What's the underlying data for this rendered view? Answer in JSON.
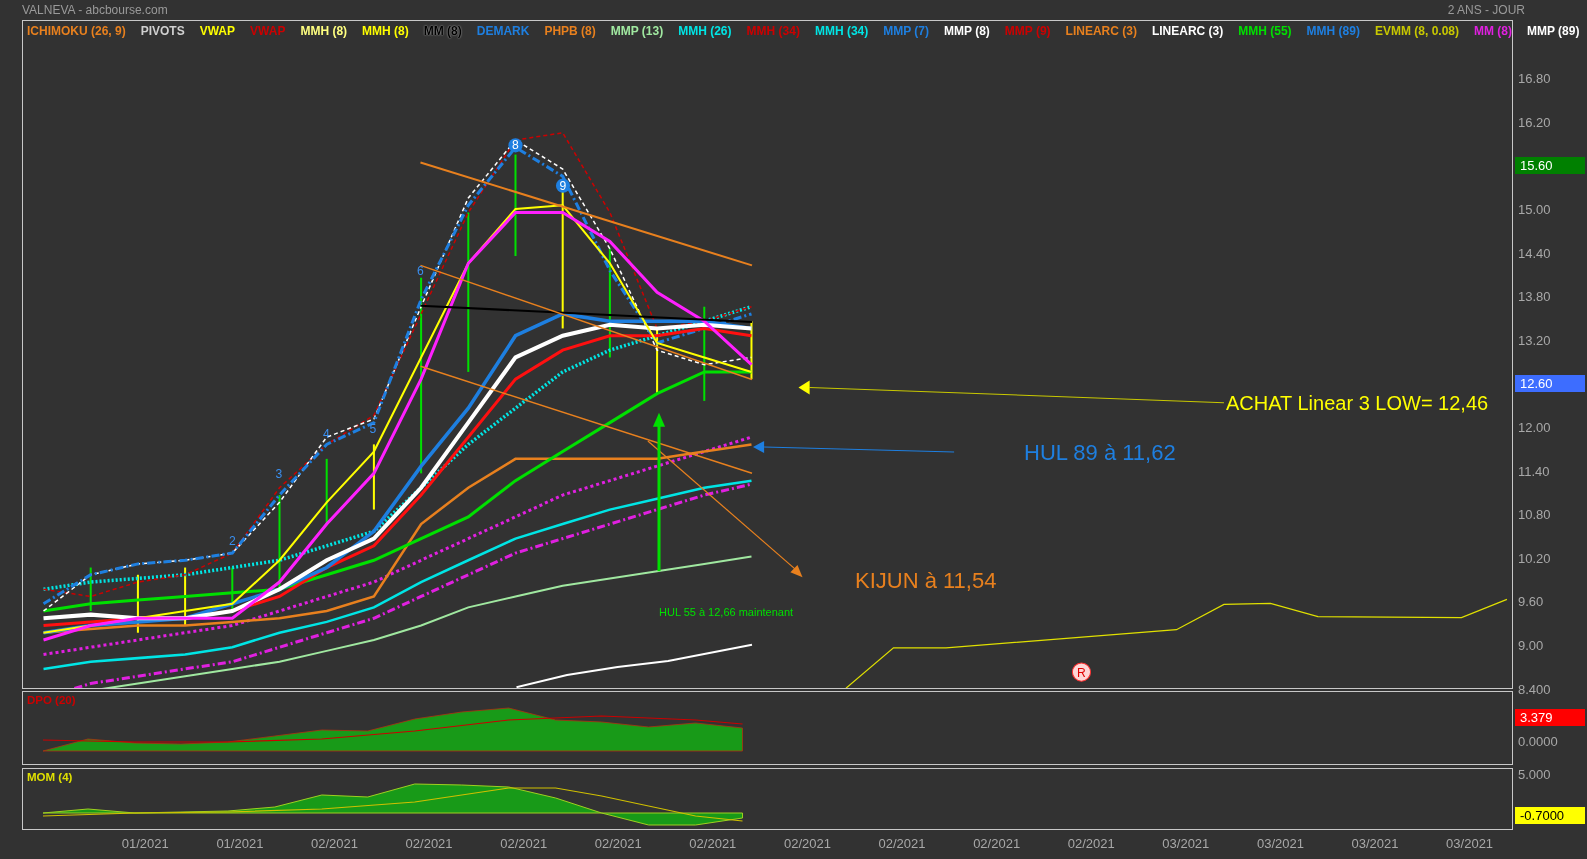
{
  "header": {
    "title": "VALNEVA - abcbourse.com",
    "period": "2 ANS - JOUR"
  },
  "legend": [
    {
      "label": "ICHIMOKU (26, 9)",
      "color": "#e8801e"
    },
    {
      "label": "PIVOTS",
      "color": "#d0d0d0"
    },
    {
      "label": "VWAP",
      "color": "#ffff00"
    },
    {
      "label": "VWAP",
      "color": "#cc0000"
    },
    {
      "label": "MMH (8)",
      "color": "#ffff80"
    },
    {
      "label": "MMH (8)",
      "color": "#ffff00"
    },
    {
      "label": "MM (8)",
      "color": "#000000"
    },
    {
      "label": "DEMARK",
      "color": "#1e7fe0"
    },
    {
      "label": "PHPB (8)",
      "color": "#e8801e"
    },
    {
      "label": "MMP (13)",
      "color": "#a0e8a0"
    },
    {
      "label": "MMH (26)",
      "color": "#00e5e5"
    },
    {
      "label": "MMH (34)",
      "color": "#cc0000"
    },
    {
      "label": "MMH (34)",
      "color": "#00e5e5"
    },
    {
      "label": "MMP (7)",
      "color": "#1e7fe0"
    },
    {
      "label": "MMP (8)",
      "color": "#ffffff"
    },
    {
      "label": "MMP (9)",
      "color": "#cc0000"
    },
    {
      "label": "LINEARC (3)",
      "color": "#e8801e"
    },
    {
      "label": "LINEARC (3)",
      "color": "#ffffff"
    },
    {
      "label": "MMH (55)",
      "color": "#00e000"
    },
    {
      "label": "MMH (89)",
      "color": "#1e7fe0"
    },
    {
      "label": "EVMM (8, 0.08)",
      "color": "#c8c800"
    },
    {
      "label": "MM (8)",
      "color": "#e020e0"
    },
    {
      "label": "MMP (89)",
      "color": "#ffffff"
    }
  ],
  "price_axis": [
    {
      "kind": "tick",
      "label": "16.80"
    },
    {
      "kind": "tick",
      "label": "16.20"
    },
    {
      "kind": "badge",
      "label": "15.60",
      "color": "#008000"
    },
    {
      "kind": "tick",
      "label": "15.00"
    },
    {
      "kind": "tick",
      "label": "14.40"
    },
    {
      "kind": "tick",
      "label": "13.80"
    },
    {
      "kind": "tick",
      "label": "13.20"
    },
    {
      "kind": "badge",
      "label": "12.60",
      "color": "#3d6dff"
    },
    {
      "kind": "tick",
      "label": "12.00"
    },
    {
      "kind": "tick",
      "label": "11.40"
    },
    {
      "kind": "tick",
      "label": "10.80"
    },
    {
      "kind": "tick",
      "label": "10.20"
    },
    {
      "kind": "tick",
      "label": "9.60"
    },
    {
      "kind": "tick",
      "label": "9.00"
    },
    {
      "kind": "tick",
      "label": "8.400"
    }
  ],
  "wave_labels": [
    {
      "label": "2",
      "kind": "plain"
    },
    {
      "label": "3",
      "kind": "plain"
    },
    {
      "label": "4",
      "kind": "plain"
    },
    {
      "label": "5",
      "kind": "plain"
    },
    {
      "label": "6",
      "kind": "plain"
    },
    {
      "label": "8",
      "kind": "circled"
    },
    {
      "label": "9",
      "kind": "circled"
    }
  ],
  "annotations": [
    {
      "text": "ACHAT Linear 3 LOW= 12,46",
      "color": "#ffff00"
    },
    {
      "text": "HUL 89 à 11,62",
      "color": "#1e7fe0"
    },
    {
      "text": "KIJUN à 11,54",
      "color": "#e8801e"
    },
    {
      "text": "HUL 55 à 12,66 maintenant",
      "color": "#00e000"
    }
  ],
  "marker": {
    "label": "R"
  },
  "dpo": {
    "title": "DPO (20)",
    "color": "#cc0000",
    "axis": [
      {
        "kind": "badge",
        "label": "3.379",
        "color": "#ff0000"
      },
      {
        "kind": "tick",
        "label": "0.0000"
      }
    ]
  },
  "mom": {
    "title": "MOM (4)",
    "color": "#e0e000",
    "axis": [
      {
        "kind": "tick",
        "label": "5.000"
      },
      {
        "kind": "badge",
        "label": "-0.7000",
        "color": "#ffff00"
      }
    ]
  },
  "x_axis": [
    "01/2021",
    "01/2021",
    "02/2021",
    "02/2021",
    "02/2021",
    "02/2021",
    "02/2021",
    "02/2021",
    "02/2021",
    "02/2021",
    "02/2021",
    "03/2021",
    "03/2021",
    "03/2021",
    "03/2021"
  ]
}
